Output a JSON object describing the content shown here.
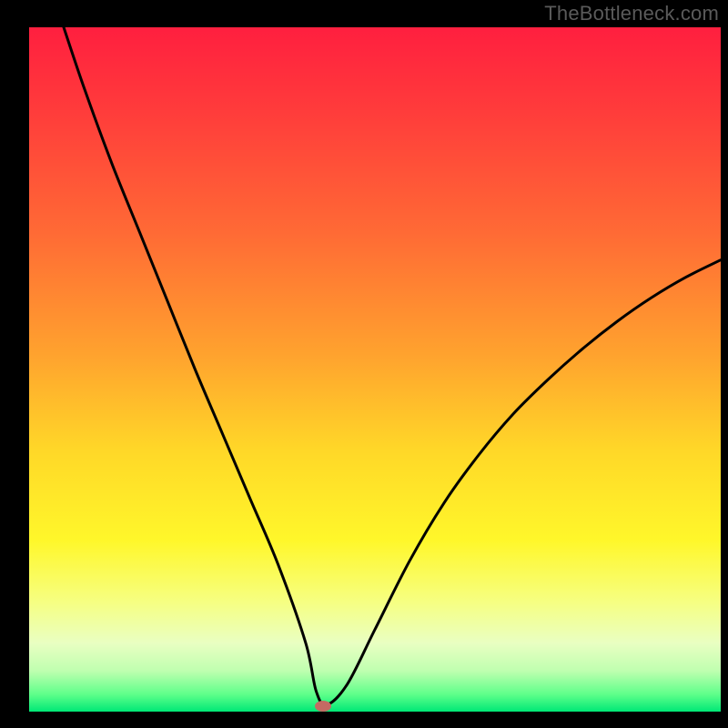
{
  "watermark": "TheBottleneck.com",
  "chart_data": {
    "type": "line",
    "title": "",
    "xlabel": "",
    "ylabel": "",
    "xlim": [
      0,
      100
    ],
    "ylim": [
      0,
      100
    ],
    "background_gradient": {
      "stops": [
        {
          "offset": 0.0,
          "color": "#ff1f3f"
        },
        {
          "offset": 0.12,
          "color": "#ff3b3b"
        },
        {
          "offset": 0.3,
          "color": "#ff6a35"
        },
        {
          "offset": 0.48,
          "color": "#ffa32e"
        },
        {
          "offset": 0.62,
          "color": "#ffd828"
        },
        {
          "offset": 0.75,
          "color": "#fff72a"
        },
        {
          "offset": 0.84,
          "color": "#f6ff82"
        },
        {
          "offset": 0.9,
          "color": "#e9ffc2"
        },
        {
          "offset": 0.94,
          "color": "#c0ffb0"
        },
        {
          "offset": 0.975,
          "color": "#5eff8a"
        },
        {
          "offset": 1.0,
          "color": "#00e876"
        }
      ]
    },
    "series": [
      {
        "name": "bottleneck-curve",
        "color": "#000000",
        "x": [
          5,
          8,
          12,
          16,
          20,
          24,
          28,
          32,
          36,
          40,
          41.5,
          43,
          46,
          50,
          55,
          60,
          65,
          70,
          75,
          80,
          85,
          90,
          95,
          100
        ],
        "y": [
          100,
          91,
          80,
          70,
          60,
          50,
          40.5,
          31,
          21.5,
          10,
          3,
          1,
          4,
          12,
          22,
          30.5,
          37.5,
          43.5,
          48.5,
          53,
          57,
          60.5,
          63.5,
          66
        ]
      }
    ],
    "marker": {
      "name": "optimal-point",
      "x": 42.5,
      "y": 0.8,
      "color": "#c46a63",
      "rx": 9,
      "ry": 6
    }
  }
}
